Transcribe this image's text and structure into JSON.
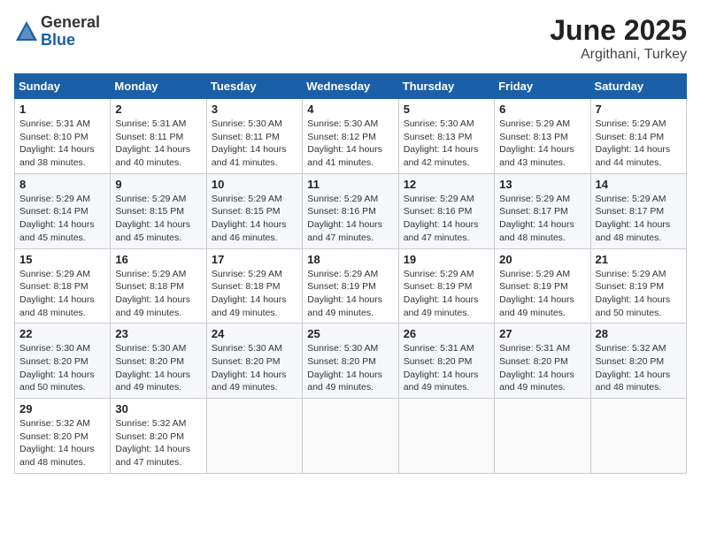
{
  "header": {
    "logo_general": "General",
    "logo_blue": "Blue",
    "month": "June 2025",
    "location": "Argithani, Turkey"
  },
  "weekdays": [
    "Sunday",
    "Monday",
    "Tuesday",
    "Wednesday",
    "Thursday",
    "Friday",
    "Saturday"
  ],
  "weeks": [
    [
      {
        "day": "1",
        "sunrise": "5:31 AM",
        "sunset": "8:10 PM",
        "daylight": "14 hours and 38 minutes."
      },
      {
        "day": "2",
        "sunrise": "5:31 AM",
        "sunset": "8:11 PM",
        "daylight": "14 hours and 40 minutes."
      },
      {
        "day": "3",
        "sunrise": "5:30 AM",
        "sunset": "8:11 PM",
        "daylight": "14 hours and 41 minutes."
      },
      {
        "day": "4",
        "sunrise": "5:30 AM",
        "sunset": "8:12 PM",
        "daylight": "14 hours and 41 minutes."
      },
      {
        "day": "5",
        "sunrise": "5:30 AM",
        "sunset": "8:13 PM",
        "daylight": "14 hours and 42 minutes."
      },
      {
        "day": "6",
        "sunrise": "5:29 AM",
        "sunset": "8:13 PM",
        "daylight": "14 hours and 43 minutes."
      },
      {
        "day": "7",
        "sunrise": "5:29 AM",
        "sunset": "8:14 PM",
        "daylight": "14 hours and 44 minutes."
      }
    ],
    [
      {
        "day": "8",
        "sunrise": "5:29 AM",
        "sunset": "8:14 PM",
        "daylight": "14 hours and 45 minutes."
      },
      {
        "day": "9",
        "sunrise": "5:29 AM",
        "sunset": "8:15 PM",
        "daylight": "14 hours and 45 minutes."
      },
      {
        "day": "10",
        "sunrise": "5:29 AM",
        "sunset": "8:15 PM",
        "daylight": "14 hours and 46 minutes."
      },
      {
        "day": "11",
        "sunrise": "5:29 AM",
        "sunset": "8:16 PM",
        "daylight": "14 hours and 47 minutes."
      },
      {
        "day": "12",
        "sunrise": "5:29 AM",
        "sunset": "8:16 PM",
        "daylight": "14 hours and 47 minutes."
      },
      {
        "day": "13",
        "sunrise": "5:29 AM",
        "sunset": "8:17 PM",
        "daylight": "14 hours and 48 minutes."
      },
      {
        "day": "14",
        "sunrise": "5:29 AM",
        "sunset": "8:17 PM",
        "daylight": "14 hours and 48 minutes."
      }
    ],
    [
      {
        "day": "15",
        "sunrise": "5:29 AM",
        "sunset": "8:18 PM",
        "daylight": "14 hours and 48 minutes."
      },
      {
        "day": "16",
        "sunrise": "5:29 AM",
        "sunset": "8:18 PM",
        "daylight": "14 hours and 49 minutes."
      },
      {
        "day": "17",
        "sunrise": "5:29 AM",
        "sunset": "8:18 PM",
        "daylight": "14 hours and 49 minutes."
      },
      {
        "day": "18",
        "sunrise": "5:29 AM",
        "sunset": "8:19 PM",
        "daylight": "14 hours and 49 minutes."
      },
      {
        "day": "19",
        "sunrise": "5:29 AM",
        "sunset": "8:19 PM",
        "daylight": "14 hours and 49 minutes."
      },
      {
        "day": "20",
        "sunrise": "5:29 AM",
        "sunset": "8:19 PM",
        "daylight": "14 hours and 49 minutes."
      },
      {
        "day": "21",
        "sunrise": "5:29 AM",
        "sunset": "8:19 PM",
        "daylight": "14 hours and 50 minutes."
      }
    ],
    [
      {
        "day": "22",
        "sunrise": "5:30 AM",
        "sunset": "8:20 PM",
        "daylight": "14 hours and 50 minutes."
      },
      {
        "day": "23",
        "sunrise": "5:30 AM",
        "sunset": "8:20 PM",
        "daylight": "14 hours and 49 minutes."
      },
      {
        "day": "24",
        "sunrise": "5:30 AM",
        "sunset": "8:20 PM",
        "daylight": "14 hours and 49 minutes."
      },
      {
        "day": "25",
        "sunrise": "5:30 AM",
        "sunset": "8:20 PM",
        "daylight": "14 hours and 49 minutes."
      },
      {
        "day": "26",
        "sunrise": "5:31 AM",
        "sunset": "8:20 PM",
        "daylight": "14 hours and 49 minutes."
      },
      {
        "day": "27",
        "sunrise": "5:31 AM",
        "sunset": "8:20 PM",
        "daylight": "14 hours and 49 minutes."
      },
      {
        "day": "28",
        "sunrise": "5:32 AM",
        "sunset": "8:20 PM",
        "daylight": "14 hours and 48 minutes."
      }
    ],
    [
      {
        "day": "29",
        "sunrise": "5:32 AM",
        "sunset": "8:20 PM",
        "daylight": "14 hours and 48 minutes."
      },
      {
        "day": "30",
        "sunrise": "5:32 AM",
        "sunset": "8:20 PM",
        "daylight": "14 hours and 47 minutes."
      },
      null,
      null,
      null,
      null,
      null
    ]
  ]
}
